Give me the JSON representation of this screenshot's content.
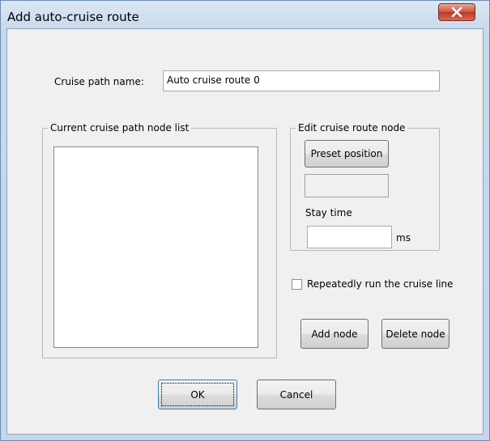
{
  "window": {
    "title": "Add auto-cruise route",
    "close_glyph": "✕"
  },
  "path_name": {
    "label": "Cruise path name:",
    "value": "Auto cruise route 0"
  },
  "node_list_group": {
    "caption": "Current cruise path node list",
    "items": []
  },
  "edit_group": {
    "caption": "Edit cruise route node",
    "preset_button": "Preset position",
    "preset_value": "",
    "stay_time_label": "Stay time",
    "stay_time_value": "",
    "stay_time_unit": "ms"
  },
  "repeat_checkbox": {
    "label": "Repeatedly run the cruise line",
    "checked": false
  },
  "buttons": {
    "add_node": "Add node",
    "delete_node": "Delete node",
    "ok": "OK",
    "cancel": "Cancel"
  },
  "colors": {
    "titlebar_bg": "#c6d8ec",
    "client_bg": "#f0f0f0",
    "close_button": "#c7533f"
  }
}
